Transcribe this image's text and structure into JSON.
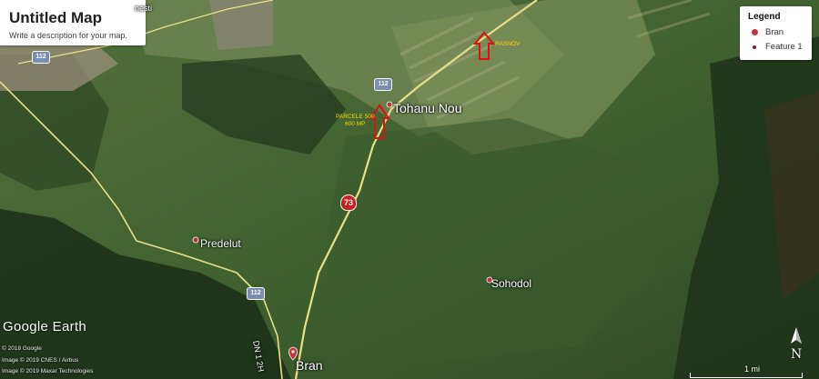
{
  "map_title": "Untitled Map",
  "map_description": "Write a description for your map.",
  "legend": {
    "heading": "Legend",
    "items": [
      {
        "label": "Bran",
        "icon": "red-pin-icon"
      },
      {
        "label": "Feature 1",
        "icon": "small-dot-icon"
      }
    ]
  },
  "places": {
    "tohanu_nou": "Tohanu Nou",
    "predelut": "Predelut",
    "sohodol": "Sohodol",
    "bran": "Bran",
    "town_top": "nesti"
  },
  "annotations": {
    "rasnov": "RASNOV",
    "parcel_line1": "PARCELE 500",
    "parcel_line2": "600 MP"
  },
  "road_shields": {
    "r73": "73",
    "r112_top": "112",
    "r112_left": "112",
    "r112_mid": "112",
    "road_label": "DN 1 2H"
  },
  "branding": "Google Earth",
  "credits": [
    "© 2018 Google",
    "Image © 2019 CNES / Airbus",
    "Image © 2019 Maxar Technologies"
  ],
  "scale_label": "1 mi",
  "north_label": "N",
  "colors": {
    "terrain": "#3c5a2c",
    "pin": "#c8323a",
    "annotation": "#ffd400",
    "road": "#e8df8a"
  }
}
